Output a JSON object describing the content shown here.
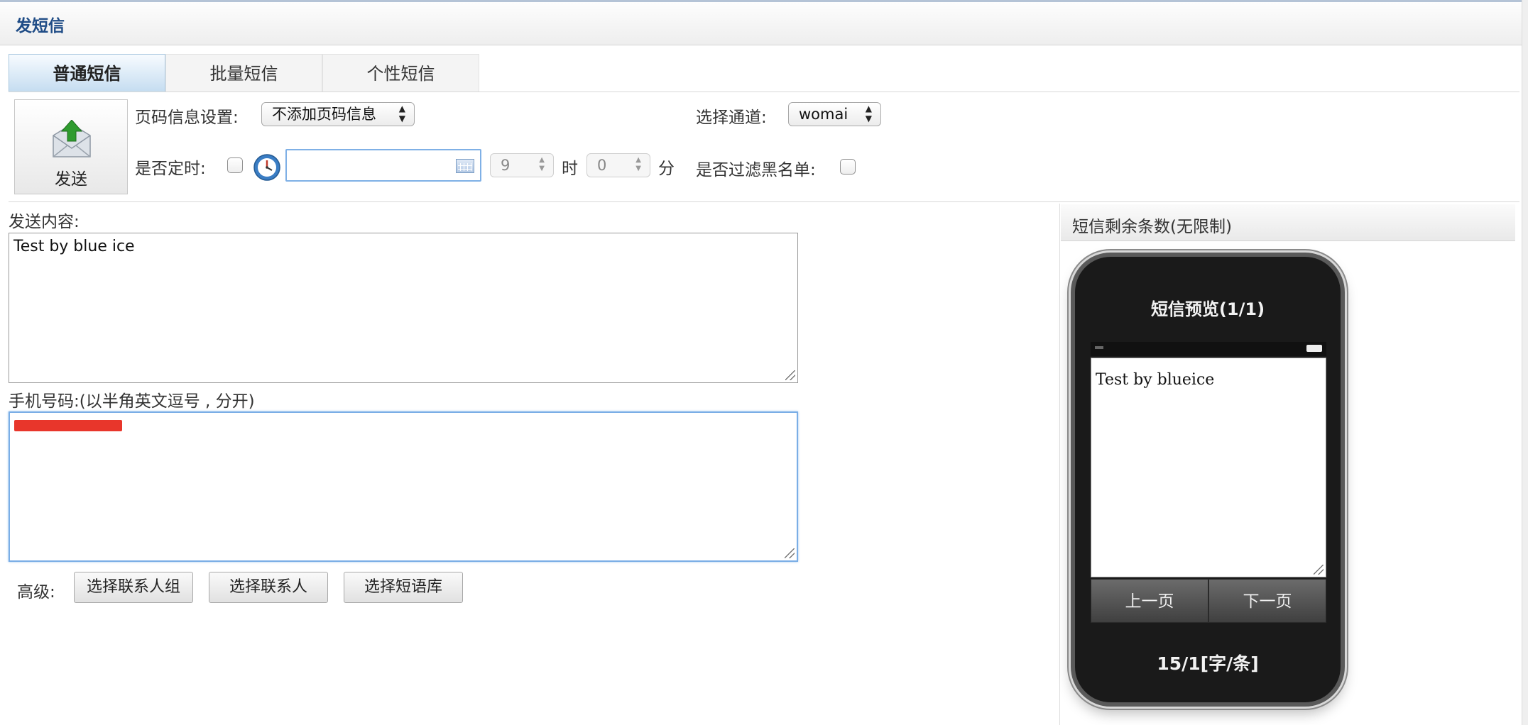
{
  "page": {
    "title": "发短信"
  },
  "tabs": [
    {
      "label": "普通短信",
      "active": true
    },
    {
      "label": "批量短信",
      "active": false
    },
    {
      "label": "个性短信",
      "active": false
    }
  ],
  "toolbar": {
    "send_label": "发送",
    "page_info_label": "页码信息设置:",
    "page_info_value": "不添加页码信息",
    "channel_label": "选择通道:",
    "channel_value": "womai",
    "schedule_label": "是否定时:",
    "hour_value": "9",
    "hour_unit": "时",
    "minute_value": "0",
    "minute_unit": "分",
    "blacklist_label": "是否过滤黑名单:"
  },
  "content": {
    "label": "发送内容:",
    "value": "Test by blue ice"
  },
  "phone_numbers": {
    "label": "手机号码:(以半角英文逗号 , 分开)"
  },
  "advanced": {
    "label": "高级:",
    "buttons": [
      "选择联系人组",
      "选择联系人",
      "选择短语库"
    ]
  },
  "preview": {
    "panel_title": "短信剩余条数(无限制)",
    "title": "短信预览(1/1)",
    "text": "Test by blueice",
    "prev_label": "上一页",
    "next_label": "下一页",
    "count": "15/1[字/条]"
  },
  "colors": {
    "title_blue": "#1f4c86",
    "tab_active": "#c4dcf0",
    "focus_border": "#7aaee6",
    "redaction": "#e8362b",
    "send_arrow": "#2e9b2e"
  },
  "icons": [
    "send-envelope-icon",
    "clock-icon",
    "calendar-icon"
  ]
}
